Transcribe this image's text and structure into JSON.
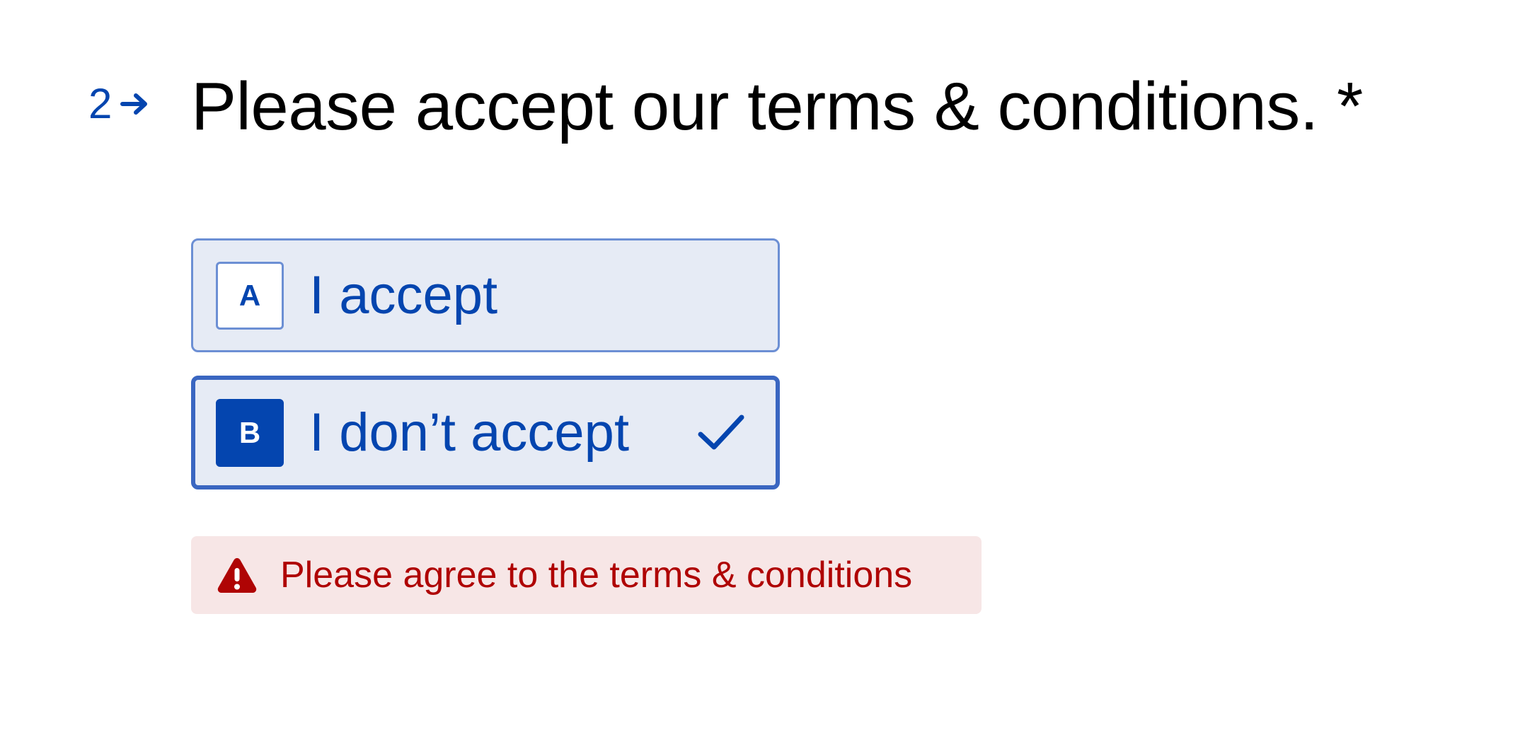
{
  "question": {
    "number": "2",
    "arrow_icon": "arrow-right-icon",
    "title": "Please accept our terms & conditions.",
    "required_marker": "*"
  },
  "choices": [
    {
      "key": "A",
      "label": "I accept",
      "selected": false
    },
    {
      "key": "B",
      "label": "I don’t accept",
      "selected": true,
      "indicator_icon": "check-icon"
    }
  ],
  "error": {
    "icon": "warning-icon",
    "message": "Please agree to the terms & conditions"
  },
  "colors": {
    "accent": "#0445AF",
    "choice_background": "#E6EBF5",
    "choice_border": "#6C8FD4",
    "selected_border": "#3A66C1",
    "error_text": "#AF0404",
    "error_background": "#F7E6E6",
    "title_text": "#000000"
  }
}
